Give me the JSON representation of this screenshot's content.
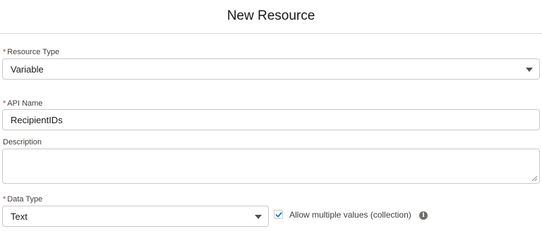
{
  "modal": {
    "title": "New Resource"
  },
  "form": {
    "resource_type": {
      "required_marker": "*",
      "label": "Resource Type",
      "value": "Variable"
    },
    "api_name": {
      "required_marker": "*",
      "label": "API Name",
      "value": "RecipientIDs"
    },
    "description": {
      "label": "Description",
      "value": ""
    },
    "data_type": {
      "required_marker": "*",
      "label": "Data Type",
      "value": "Text"
    },
    "allow_multiple": {
      "label": "Allow multiple values (collection)",
      "checked": true
    },
    "info_icon_glyph": "i"
  },
  "icons": {
    "dropdown": "chevron-down-icon",
    "checkmark": "check-icon",
    "info": "info-icon",
    "resize": "resize-handle-icon"
  },
  "colors": {
    "required": "#c23934",
    "checkmark": "#0176d3",
    "border": "#c9c9c9",
    "info_icon": "#706e6b"
  }
}
